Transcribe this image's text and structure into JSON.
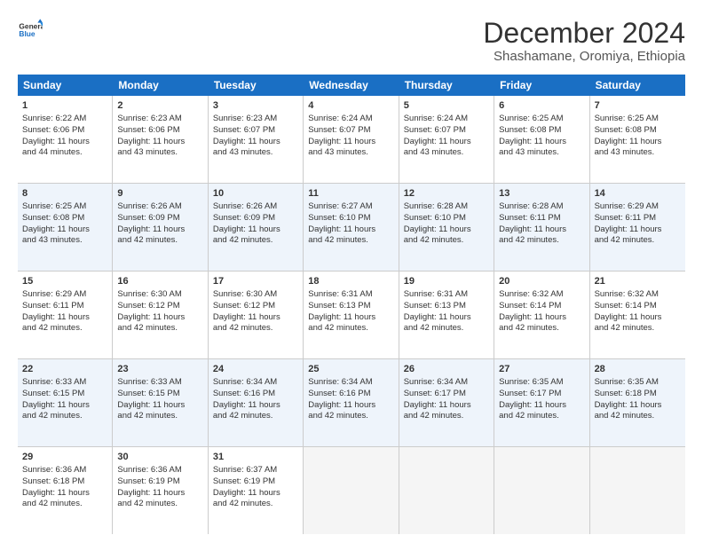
{
  "logo": {
    "line1": "General",
    "line2": "Blue"
  },
  "title": "December 2024",
  "subtitle": "Shashamane, Oromiya, Ethiopia",
  "days_of_week": [
    "Sunday",
    "Monday",
    "Tuesday",
    "Wednesday",
    "Thursday",
    "Friday",
    "Saturday"
  ],
  "weeks": [
    [
      {
        "day": "1",
        "lines": [
          "Sunrise: 6:22 AM",
          "Sunset: 6:06 PM",
          "Daylight: 11 hours",
          "and 44 minutes."
        ]
      },
      {
        "day": "2",
        "lines": [
          "Sunrise: 6:23 AM",
          "Sunset: 6:06 PM",
          "Daylight: 11 hours",
          "and 43 minutes."
        ]
      },
      {
        "day": "3",
        "lines": [
          "Sunrise: 6:23 AM",
          "Sunset: 6:07 PM",
          "Daylight: 11 hours",
          "and 43 minutes."
        ]
      },
      {
        "day": "4",
        "lines": [
          "Sunrise: 6:24 AM",
          "Sunset: 6:07 PM",
          "Daylight: 11 hours",
          "and 43 minutes."
        ]
      },
      {
        "day": "5",
        "lines": [
          "Sunrise: 6:24 AM",
          "Sunset: 6:07 PM",
          "Daylight: 11 hours",
          "and 43 minutes."
        ]
      },
      {
        "day": "6",
        "lines": [
          "Sunrise: 6:25 AM",
          "Sunset: 6:08 PM",
          "Daylight: 11 hours",
          "and 43 minutes."
        ]
      },
      {
        "day": "7",
        "lines": [
          "Sunrise: 6:25 AM",
          "Sunset: 6:08 PM",
          "Daylight: 11 hours",
          "and 43 minutes."
        ]
      }
    ],
    [
      {
        "day": "8",
        "lines": [
          "Sunrise: 6:25 AM",
          "Sunset: 6:08 PM",
          "Daylight: 11 hours",
          "and 43 minutes."
        ]
      },
      {
        "day": "9",
        "lines": [
          "Sunrise: 6:26 AM",
          "Sunset: 6:09 PM",
          "Daylight: 11 hours",
          "and 42 minutes."
        ]
      },
      {
        "day": "10",
        "lines": [
          "Sunrise: 6:26 AM",
          "Sunset: 6:09 PM",
          "Daylight: 11 hours",
          "and 42 minutes."
        ]
      },
      {
        "day": "11",
        "lines": [
          "Sunrise: 6:27 AM",
          "Sunset: 6:10 PM",
          "Daylight: 11 hours",
          "and 42 minutes."
        ]
      },
      {
        "day": "12",
        "lines": [
          "Sunrise: 6:28 AM",
          "Sunset: 6:10 PM",
          "Daylight: 11 hours",
          "and 42 minutes."
        ]
      },
      {
        "day": "13",
        "lines": [
          "Sunrise: 6:28 AM",
          "Sunset: 6:11 PM",
          "Daylight: 11 hours",
          "and 42 minutes."
        ]
      },
      {
        "day": "14",
        "lines": [
          "Sunrise: 6:29 AM",
          "Sunset: 6:11 PM",
          "Daylight: 11 hours",
          "and 42 minutes."
        ]
      }
    ],
    [
      {
        "day": "15",
        "lines": [
          "Sunrise: 6:29 AM",
          "Sunset: 6:11 PM",
          "Daylight: 11 hours",
          "and 42 minutes."
        ]
      },
      {
        "day": "16",
        "lines": [
          "Sunrise: 6:30 AM",
          "Sunset: 6:12 PM",
          "Daylight: 11 hours",
          "and 42 minutes."
        ]
      },
      {
        "day": "17",
        "lines": [
          "Sunrise: 6:30 AM",
          "Sunset: 6:12 PM",
          "Daylight: 11 hours",
          "and 42 minutes."
        ]
      },
      {
        "day": "18",
        "lines": [
          "Sunrise: 6:31 AM",
          "Sunset: 6:13 PM",
          "Daylight: 11 hours",
          "and 42 minutes."
        ]
      },
      {
        "day": "19",
        "lines": [
          "Sunrise: 6:31 AM",
          "Sunset: 6:13 PM",
          "Daylight: 11 hours",
          "and 42 minutes."
        ]
      },
      {
        "day": "20",
        "lines": [
          "Sunrise: 6:32 AM",
          "Sunset: 6:14 PM",
          "Daylight: 11 hours",
          "and 42 minutes."
        ]
      },
      {
        "day": "21",
        "lines": [
          "Sunrise: 6:32 AM",
          "Sunset: 6:14 PM",
          "Daylight: 11 hours",
          "and 42 minutes."
        ]
      }
    ],
    [
      {
        "day": "22",
        "lines": [
          "Sunrise: 6:33 AM",
          "Sunset: 6:15 PM",
          "Daylight: 11 hours",
          "and 42 minutes."
        ]
      },
      {
        "day": "23",
        "lines": [
          "Sunrise: 6:33 AM",
          "Sunset: 6:15 PM",
          "Daylight: 11 hours",
          "and 42 minutes."
        ]
      },
      {
        "day": "24",
        "lines": [
          "Sunrise: 6:34 AM",
          "Sunset: 6:16 PM",
          "Daylight: 11 hours",
          "and 42 minutes."
        ]
      },
      {
        "day": "25",
        "lines": [
          "Sunrise: 6:34 AM",
          "Sunset: 6:16 PM",
          "Daylight: 11 hours",
          "and 42 minutes."
        ]
      },
      {
        "day": "26",
        "lines": [
          "Sunrise: 6:34 AM",
          "Sunset: 6:17 PM",
          "Daylight: 11 hours",
          "and 42 minutes."
        ]
      },
      {
        "day": "27",
        "lines": [
          "Sunrise: 6:35 AM",
          "Sunset: 6:17 PM",
          "Daylight: 11 hours",
          "and 42 minutes."
        ]
      },
      {
        "day": "28",
        "lines": [
          "Sunrise: 6:35 AM",
          "Sunset: 6:18 PM",
          "Daylight: 11 hours",
          "and 42 minutes."
        ]
      }
    ],
    [
      {
        "day": "29",
        "lines": [
          "Sunrise: 6:36 AM",
          "Sunset: 6:18 PM",
          "Daylight: 11 hours",
          "and 42 minutes."
        ]
      },
      {
        "day": "30",
        "lines": [
          "Sunrise: 6:36 AM",
          "Sunset: 6:19 PM",
          "Daylight: 11 hours",
          "and 42 minutes."
        ]
      },
      {
        "day": "31",
        "lines": [
          "Sunrise: 6:37 AM",
          "Sunset: 6:19 PM",
          "Daylight: 11 hours",
          "and 42 minutes."
        ]
      },
      null,
      null,
      null,
      null
    ]
  ],
  "accent_color": "#1a6fc4"
}
